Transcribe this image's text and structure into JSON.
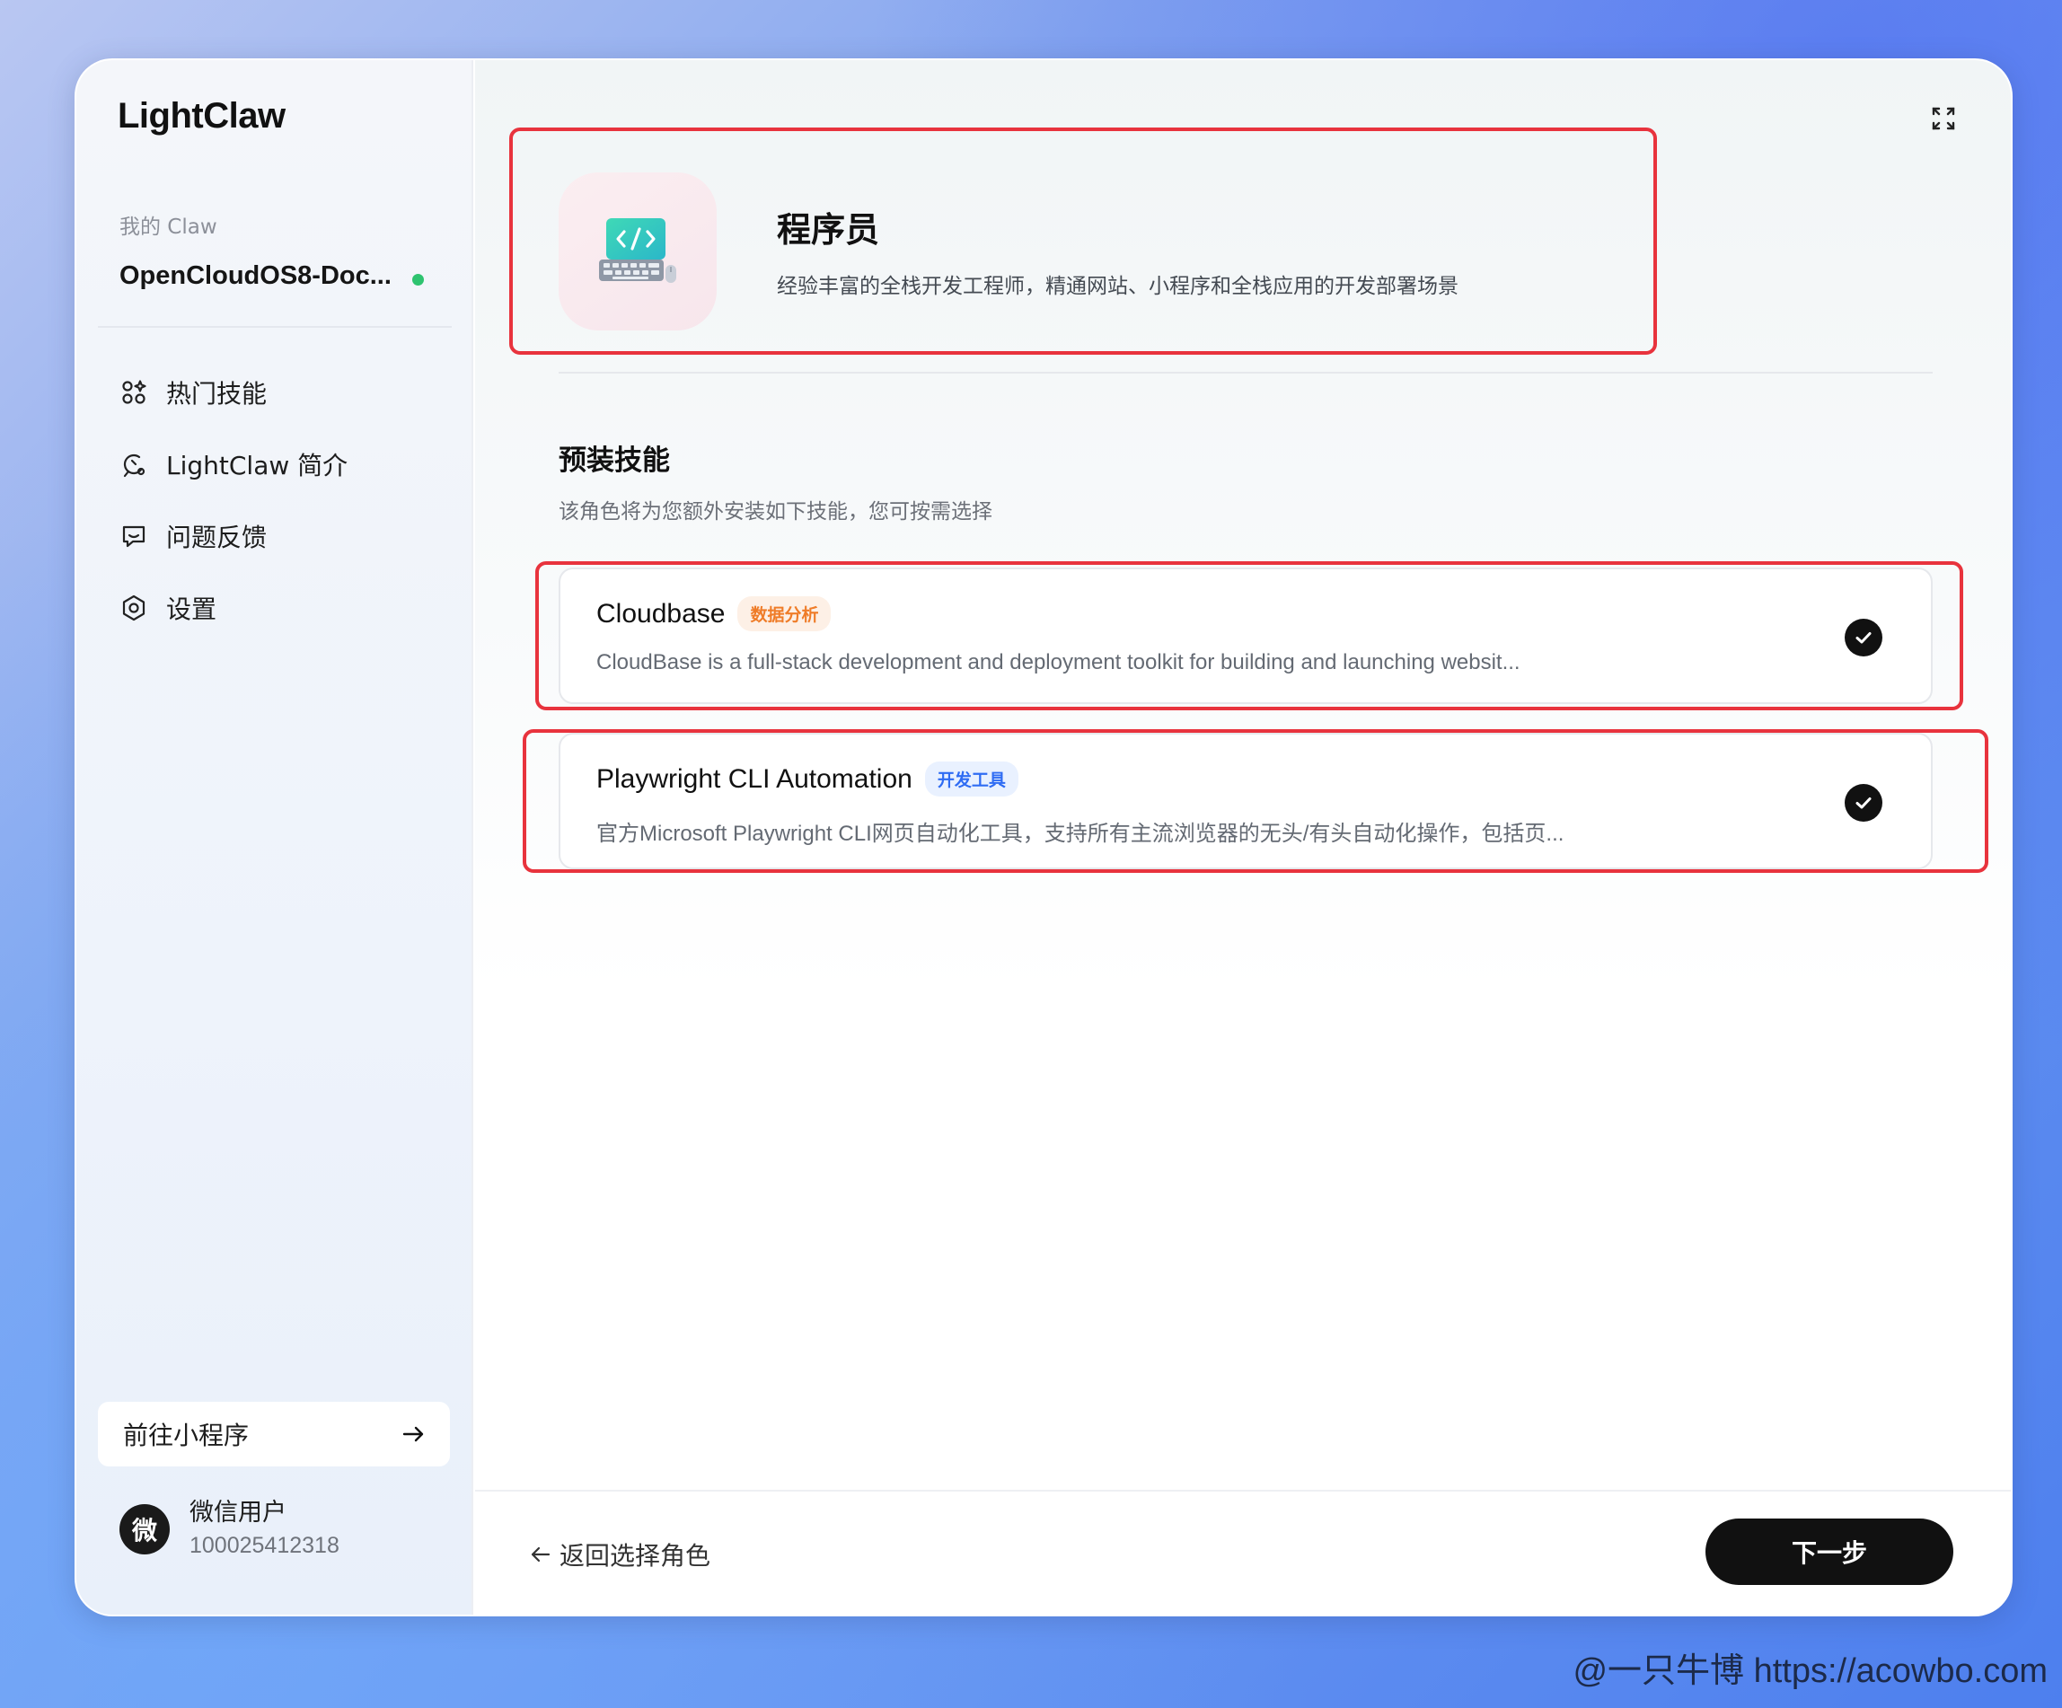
{
  "sidebar": {
    "logo": "LightClaw",
    "my_claw_label": "我的 Claw",
    "claw_name": "OpenCloudOS8-Doc...",
    "nav": [
      {
        "label": "热门技能",
        "icon": "apps-sparkle-icon"
      },
      {
        "label": "LightClaw 简介",
        "icon": "claw-info-icon"
      },
      {
        "label": "问题反馈",
        "icon": "feedback-icon"
      },
      {
        "label": "设置",
        "icon": "settings-icon"
      }
    ],
    "mini_program_label": "前往小程序",
    "user": {
      "avatar_text": "微",
      "name": "微信用户",
      "id": "100025412318"
    }
  },
  "role": {
    "title": "程序员",
    "description": "经验丰富的全栈开发工程师，精通网站、小程序和全栈应用的开发部署场景"
  },
  "skills_section": {
    "title": "预装技能",
    "subtitle": "该角色将为您额外安装如下技能，您可按需选择",
    "skills": [
      {
        "name": "Cloudbase",
        "tag": "数据分析",
        "description": "CloudBase is a full-stack development and deployment toolkit for building and launching websit..."
      },
      {
        "name": "Playwright CLI Automation",
        "tag": "开发工具",
        "description": "官方Microsoft Playwright CLI网页自动化工具，支持所有主流浏览器的无头/有头自动化操作，包括页..."
      }
    ]
  },
  "footer": {
    "back_label": "返回选择角色",
    "next_label": "下一步"
  },
  "watermark": "@一只牛博 https://acowbo.com",
  "colors": {
    "highlight": "#e8333d",
    "status_online": "#2ec36f",
    "tag_orange": "#ef7c28",
    "tag_blue": "#2f6cf3",
    "primary_button": "#111111"
  }
}
